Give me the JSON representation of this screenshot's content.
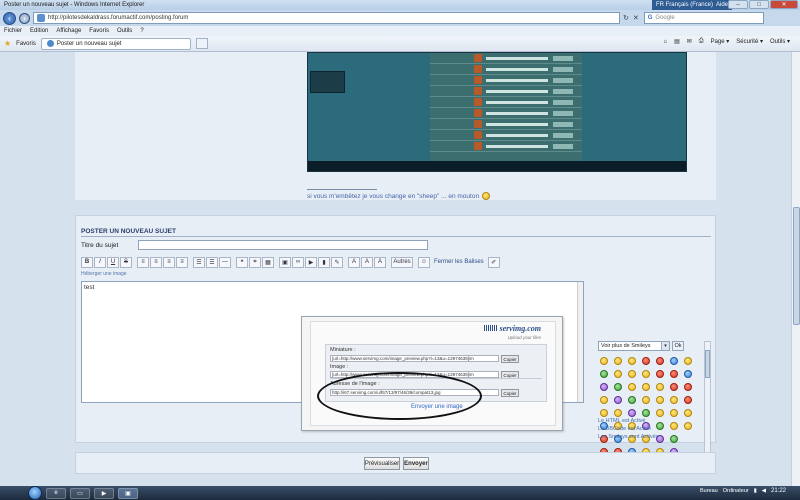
{
  "window": {
    "title": "Poster un nouveau sujet - Windows Internet Explorer",
    "language": "FR Français (France)",
    "help": "Aide",
    "buttons": {
      "minimize": "–",
      "maximize": "□",
      "close": "✕"
    }
  },
  "addressbar": {
    "url": "http://pilotesdekaldrass.forumactif.com/posting.forum",
    "search_placeholder": "Google"
  },
  "menu": [
    "Fichier",
    "Edition",
    "Affichage",
    "Favoris",
    "Outils",
    "?"
  ],
  "favorites": {
    "label": "Favoris",
    "tab_title": "Poster un nouveau sujet",
    "right_tools": [
      "Page ▾",
      "Sécurité ▾",
      "Outils ▾"
    ]
  },
  "post": {
    "signature": "si vous m'embêtez je vous change en \"sheep\" ... en mouton"
  },
  "form": {
    "header": "POSTER UN NOUVEAU SUJET",
    "subject_label": "Titre du sujet",
    "toolbar": {
      "bold": "B",
      "italic": "I",
      "underline": "U",
      "strike": "S",
      "more": "Autres",
      "close_tags": "Fermer les Balises"
    },
    "host_link": "Héberger une image",
    "message_text": "test"
  },
  "servimg": {
    "logo": "servimg.com",
    "tagline": "Upload your files",
    "thumbnail_label": "Miniature :",
    "thumbnail_value": "[url=http://www.servimg.com/image_preview.php?i=13&u=13974639]im",
    "image_label": "Image :",
    "image_value": "[url=http://www.servimg.com/image_preview.php?i=13&u=13974639]im",
    "address_label": "Adresse de l'image :",
    "address_value": "http://i67.servimg.com/u/f67/13/97/46/39/compat13.jpg",
    "copy_label": "Copier",
    "send_another": "Envoyer une image"
  },
  "smileys": {
    "select_value": "Voir plus de Smileys",
    "ok": "Ok",
    "html_status": "Le HTML est Activé",
    "bbcode_status": "Le BBCode est Activé",
    "smileys_status": "Les Smileys sont Activés"
  },
  "buttons": {
    "preview": "Prévisualiser",
    "send": "Envoyer"
  },
  "taskbar": {
    "desktop_label": "Bureau",
    "computer_label": "Ordinateur",
    "clock": "21:22"
  },
  "colors": {
    "accent": "#2c4f8a",
    "link": "#3f6dac",
    "page_bg": "#d6e1ee"
  }
}
